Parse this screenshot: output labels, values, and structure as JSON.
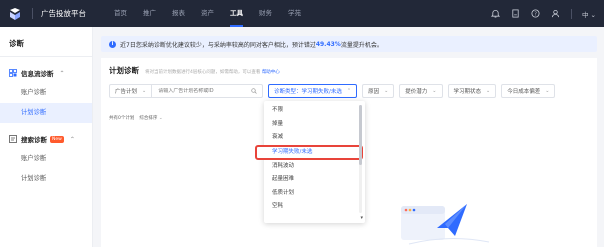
{
  "topbar": {
    "platform_name": "广告投放平台",
    "nav": [
      "首页",
      "推广",
      "报表",
      "资产",
      "工具",
      "财务",
      "学苑"
    ],
    "active_nav_index": 4,
    "lang": "中"
  },
  "sidebar": {
    "title": "诊断",
    "groups": [
      {
        "label": "信息流诊断",
        "items": [
          "账户诊断",
          "计划诊断"
        ],
        "active_item": 1,
        "new_badge": ""
      },
      {
        "label": "搜索诊断",
        "items": [
          "账户诊断",
          "计划诊断"
        ],
        "new_badge": "New"
      }
    ]
  },
  "notice": {
    "text_before": "近7日您采纳诊断优化建议较少，与采纳率较高的同对客户相比，预计错过",
    "highlight": "49.43%",
    "text_after": "流量提升机会。"
  },
  "panel": {
    "title": "计划诊断",
    "desc": "将对当前计划数据进行4层核心问题，如需帮助，可以查看",
    "help_link": "帮助中心",
    "filters": {
      "scope": "广告计划",
      "search_placeholder": "请输入广告计划名称或ID",
      "type_label": "诊断类型：学习期失败/未选",
      "reason": "原因",
      "suggestion": "提价潜力",
      "learning_state": "学习期状态",
      "cost_drop": "今日成本偏差"
    },
    "sort": {
      "count_text": "共有0个计划",
      "order_label": "综合排序"
    }
  },
  "dropdown": {
    "items": [
      "不限",
      "掉量",
      "衰减",
      "学习期失败/未选",
      "消耗波动",
      "起量困难",
      "低质计划",
      "空耗"
    ],
    "highlight_index": 3,
    "selected_index": 3
  }
}
